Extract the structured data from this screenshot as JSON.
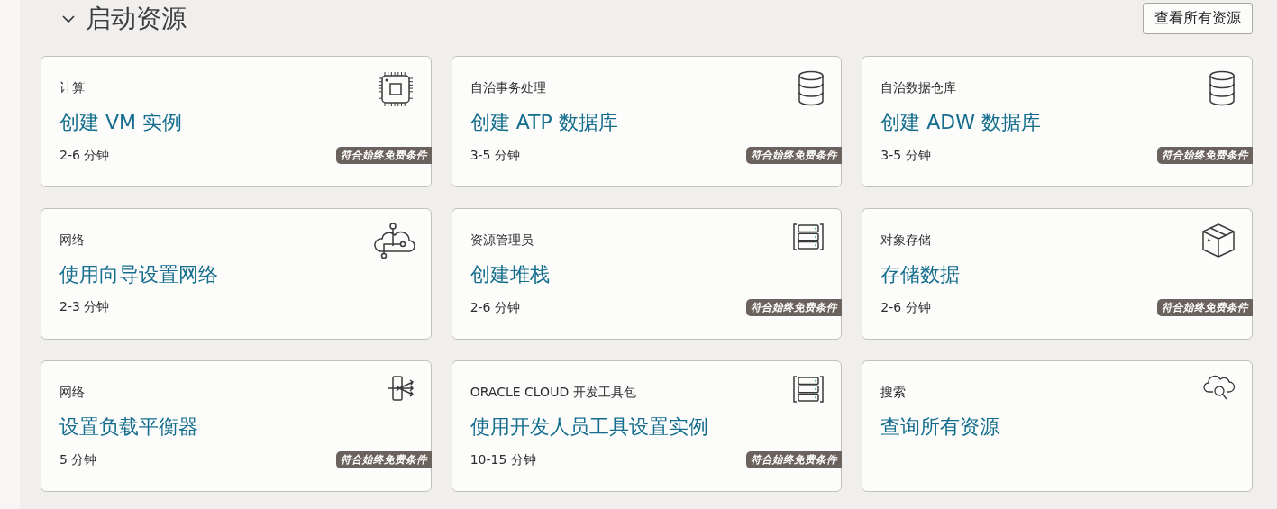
{
  "section": {
    "title": "启动资源",
    "expanded": true,
    "action": "查看所有资源"
  },
  "cards": [
    {
      "category": "计算",
      "title": "创建 VM 实例",
      "time": "2-6 分钟",
      "kind": "chip",
      "badge": "符合始终免费条件"
    },
    {
      "category": "自治事务处理",
      "title": "创建 ATP 数据库",
      "time": "3-5 分钟",
      "kind": "database",
      "badge": "符合始终免费条件"
    },
    {
      "category": "自治数据仓库",
      "title": "创建 ADW 数据库",
      "time": "3-5 分钟",
      "kind": "database",
      "badge": "符合始终免费条件"
    },
    {
      "category": "网络",
      "title": "使用向导设置网络",
      "time": "2-3 分钟",
      "kind": "network"
    },
    {
      "category": "资源管理员",
      "title": "创建堆栈",
      "time": "2-6 分钟",
      "kind": "stack",
      "badge": "符合始终免费条件"
    },
    {
      "category": "对象存储",
      "title": "存储数据",
      "time": "2-6 分钟",
      "kind": "box",
      "badge": "符合始终免费条件"
    },
    {
      "category": "网络",
      "title": "设置负载平衡器",
      "time": "5 分钟",
      "kind": "load-balancer",
      "badge": "符合始终免费条件"
    },
    {
      "category": "ORACLE CLOUD 开发工具包",
      "title": "使用开发人员工具设置实例",
      "time": "10-15 分钟",
      "kind": "stack",
      "badge": "符合始终免费条件"
    },
    {
      "category": "搜索",
      "title": "查询所有资源",
      "kind": "cloud-search"
    }
  ]
}
